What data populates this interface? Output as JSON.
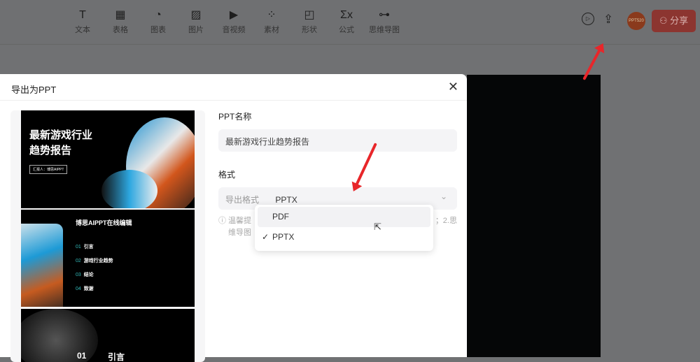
{
  "toolbar": {
    "items": [
      {
        "icon": "T",
        "label": "文本"
      },
      {
        "icon": "▦",
        "label": "表格"
      },
      {
        "icon": "◔",
        "label": "图表"
      },
      {
        "icon": "▨",
        "label": "图片"
      },
      {
        "icon": "▶",
        "label": "音视频"
      },
      {
        "icon": "⁘",
        "label": "素材"
      },
      {
        "icon": "◰",
        "label": "形状"
      },
      {
        "icon": "Σx",
        "label": "公式"
      },
      {
        "icon": "⊶",
        "label": "思维导图"
      }
    ],
    "play_icon": "▷",
    "export_icon": "⇪",
    "avatar_text": "PPT520",
    "share_label": "⚇ 分享"
  },
  "modal": {
    "title": "导出为PPT",
    "close": "✕",
    "preview": {
      "slide1_title1": "最新游戏行业",
      "slide1_title2": "趋势报告",
      "slide1_button": "汇报人：博思AIPPT",
      "slide2_title": "博思AIPPT在线编辑",
      "toc": [
        {
          "num": "01",
          "text": "引言"
        },
        {
          "num": "02",
          "text": "游戏行业趋势"
        },
        {
          "num": "03",
          "text": "结论"
        },
        {
          "num": "04",
          "text": "致谢"
        }
      ],
      "slide3_num": "01",
      "slide3_title": "引言"
    },
    "name_label": "PPT名称",
    "name_value": "最新游戏行业趋势报告",
    "format_label": "格式",
    "format_prefix": "导出格式",
    "format_value": "PPTX",
    "chevron": "⌄",
    "tip_left": "ⓘ 温馨提",
    "tip_right": "；2.思",
    "tip_line2": "维导图",
    "options": [
      {
        "label": "PDF",
        "checked": false
      },
      {
        "label": "PPTX",
        "checked": true
      }
    ],
    "check": "✓"
  },
  "colors": {
    "accent": "#e8262a",
    "share": "#8c3530"
  }
}
